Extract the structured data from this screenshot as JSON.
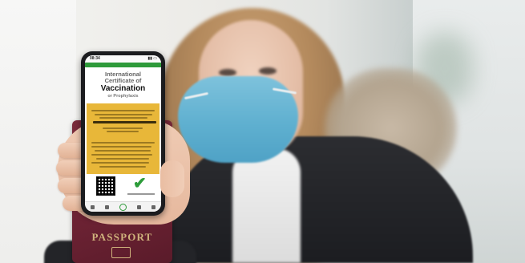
{
  "phone": {
    "status_time": "08:34",
    "certificate_title_line1": "International",
    "certificate_title_line2": "Certificate of",
    "certificate_title_line3": "Vaccination",
    "certificate_title_line4": "or Prophylaxis"
  },
  "passport": {
    "label": "PASSPORT"
  },
  "colors": {
    "certificate_accent": "#e8b739",
    "app_bar": "#2e9a3a",
    "passport_cover": "#6b2233",
    "mask": "#5fb0d0"
  },
  "icons": [
    "qr-code-icon",
    "checkmark-icon",
    "nav-home-icon",
    "nav-add-icon",
    "nav-settings-icon"
  ]
}
